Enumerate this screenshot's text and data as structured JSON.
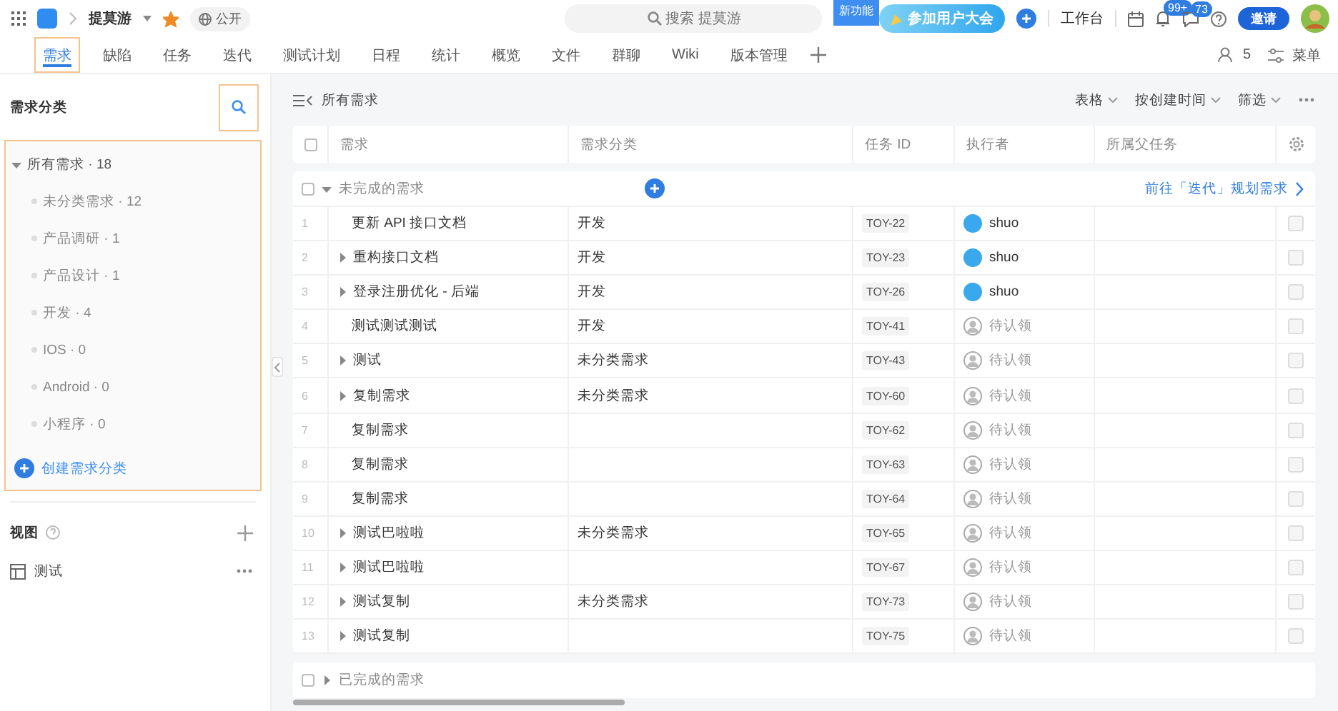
{
  "topbar": {
    "project_name": "提莫游",
    "starred": true,
    "visibility": "公开",
    "search_placeholder": "搜索 提莫游",
    "new_badge": "新功能",
    "promo": "参加用户大会",
    "workbench": "工作台",
    "notifications": "99+",
    "messages": "73",
    "invite": "邀请"
  },
  "tabs": [
    {
      "label": "需求",
      "selected": true,
      "highlighted": true
    },
    {
      "label": "缺陷",
      "selected": false,
      "highlighted": false
    },
    {
      "label": "任务",
      "selected": false,
      "highlighted": false
    },
    {
      "label": "迭代",
      "selected": false,
      "highlighted": false
    },
    {
      "label": "测试计划",
      "selected": false,
      "highlighted": false
    },
    {
      "label": "日程",
      "selected": false,
      "highlighted": false
    },
    {
      "label": "统计",
      "selected": false,
      "highlighted": false
    },
    {
      "label": "概览",
      "selected": false,
      "highlighted": false
    },
    {
      "label": "文件",
      "selected": false,
      "highlighted": false
    },
    {
      "label": "群聊",
      "selected": false,
      "highlighted": false
    },
    {
      "label": "Wiki",
      "selected": false,
      "highlighted": false
    },
    {
      "label": "版本管理",
      "selected": false,
      "highlighted": false
    }
  ],
  "members_count": "5",
  "menu": "菜单",
  "sidebar": {
    "title": "需求分类",
    "search_highlighted": true,
    "panel_highlighted": true,
    "categories": {
      "label": "所有需求 · 18",
      "expanded": true,
      "children": [
        {
          "label": "未分类需求 · 12"
        },
        {
          "label": "产品调研 · 1"
        },
        {
          "label": "产品设计 · 1"
        },
        {
          "label": "开发 · 4"
        },
        {
          "label": "IOS · 0"
        },
        {
          "label": "Android · 0"
        },
        {
          "label": "小程序 · 0"
        }
      ]
    },
    "create": "创建需求分类",
    "views_title": "视图",
    "views": [
      {
        "label": "测试"
      }
    ]
  },
  "breadcrumb": "所有需求",
  "toolbar": [
    "表格",
    "按创建时间",
    "筛选"
  ],
  "table": {
    "header_checked": false,
    "columns": [
      "需求",
      "需求分类",
      "任务 ID",
      "执行者",
      "所属父任务"
    ],
    "groups": [
      {
        "label": "未完成的需求",
        "expanded": true,
        "checked": false,
        "link": "前往「迭代」规划需求",
        "rows": [
          {
            "index": "1",
            "title": "更新 API 接口文档",
            "has_children": false,
            "category": "开发",
            "id": "TOY-22",
            "assignee": "shuo",
            "assigned": true,
            "checked": false
          },
          {
            "index": "2",
            "title": "重构接口文档",
            "has_children": true,
            "category": "开发",
            "id": "TOY-23",
            "assignee": "shuo",
            "assigned": true,
            "checked": false
          },
          {
            "index": "3",
            "title": "登录注册优化 - 后端",
            "has_children": true,
            "category": "开发",
            "id": "TOY-26",
            "assignee": "shuo",
            "assigned": true,
            "checked": false
          },
          {
            "index": "4",
            "title": "测试测试测试",
            "has_children": false,
            "category": "开发",
            "id": "TOY-41",
            "assignee": "待认领",
            "assigned": false,
            "checked": false
          },
          {
            "index": "5",
            "title": "测试",
            "has_children": true,
            "category": "未分类需求",
            "id": "TOY-43",
            "assignee": "待认领",
            "assigned": false,
            "checked": false
          },
          {
            "index": "6",
            "title": "复制需求",
            "has_children": true,
            "category": "未分类需求",
            "id": "TOY-60",
            "assignee": "待认领",
            "assigned": false,
            "checked": false
          },
          {
            "index": "7",
            "title": "复制需求",
            "has_children": false,
            "id": "TOY-62",
            "assignee": "待认领",
            "assigned": false,
            "checked": false
          },
          {
            "index": "8",
            "title": "复制需求",
            "has_children": false,
            "id": "TOY-63",
            "assignee": "待认领",
            "assigned": false,
            "checked": false
          },
          {
            "index": "9",
            "title": "复制需求",
            "has_children": false,
            "id": "TOY-64",
            "assignee": "待认领",
            "assigned": false,
            "checked": false
          },
          {
            "index": "10",
            "title": "测试巴啦啦",
            "has_children": true,
            "category": "未分类需求",
            "id": "TOY-65",
            "assignee": "待认领",
            "assigned": false,
            "checked": false
          },
          {
            "index": "11",
            "title": "测试巴啦啦",
            "has_children": true,
            "id": "TOY-67",
            "assignee": "待认领",
            "assigned": false,
            "checked": false
          },
          {
            "index": "12",
            "title": "测试复制",
            "has_children": true,
            "category": "未分类需求",
            "id": "TOY-73",
            "assignee": "待认领",
            "assigned": false,
            "checked": false
          },
          {
            "index": "13",
            "title": "测试复制",
            "has_children": true,
            "id": "TOY-75",
            "assignee": "待认领",
            "assigned": false,
            "checked": false
          }
        ]
      },
      {
        "label": "已完成的需求",
        "expanded": false,
        "checked": false
      }
    ]
  }
}
